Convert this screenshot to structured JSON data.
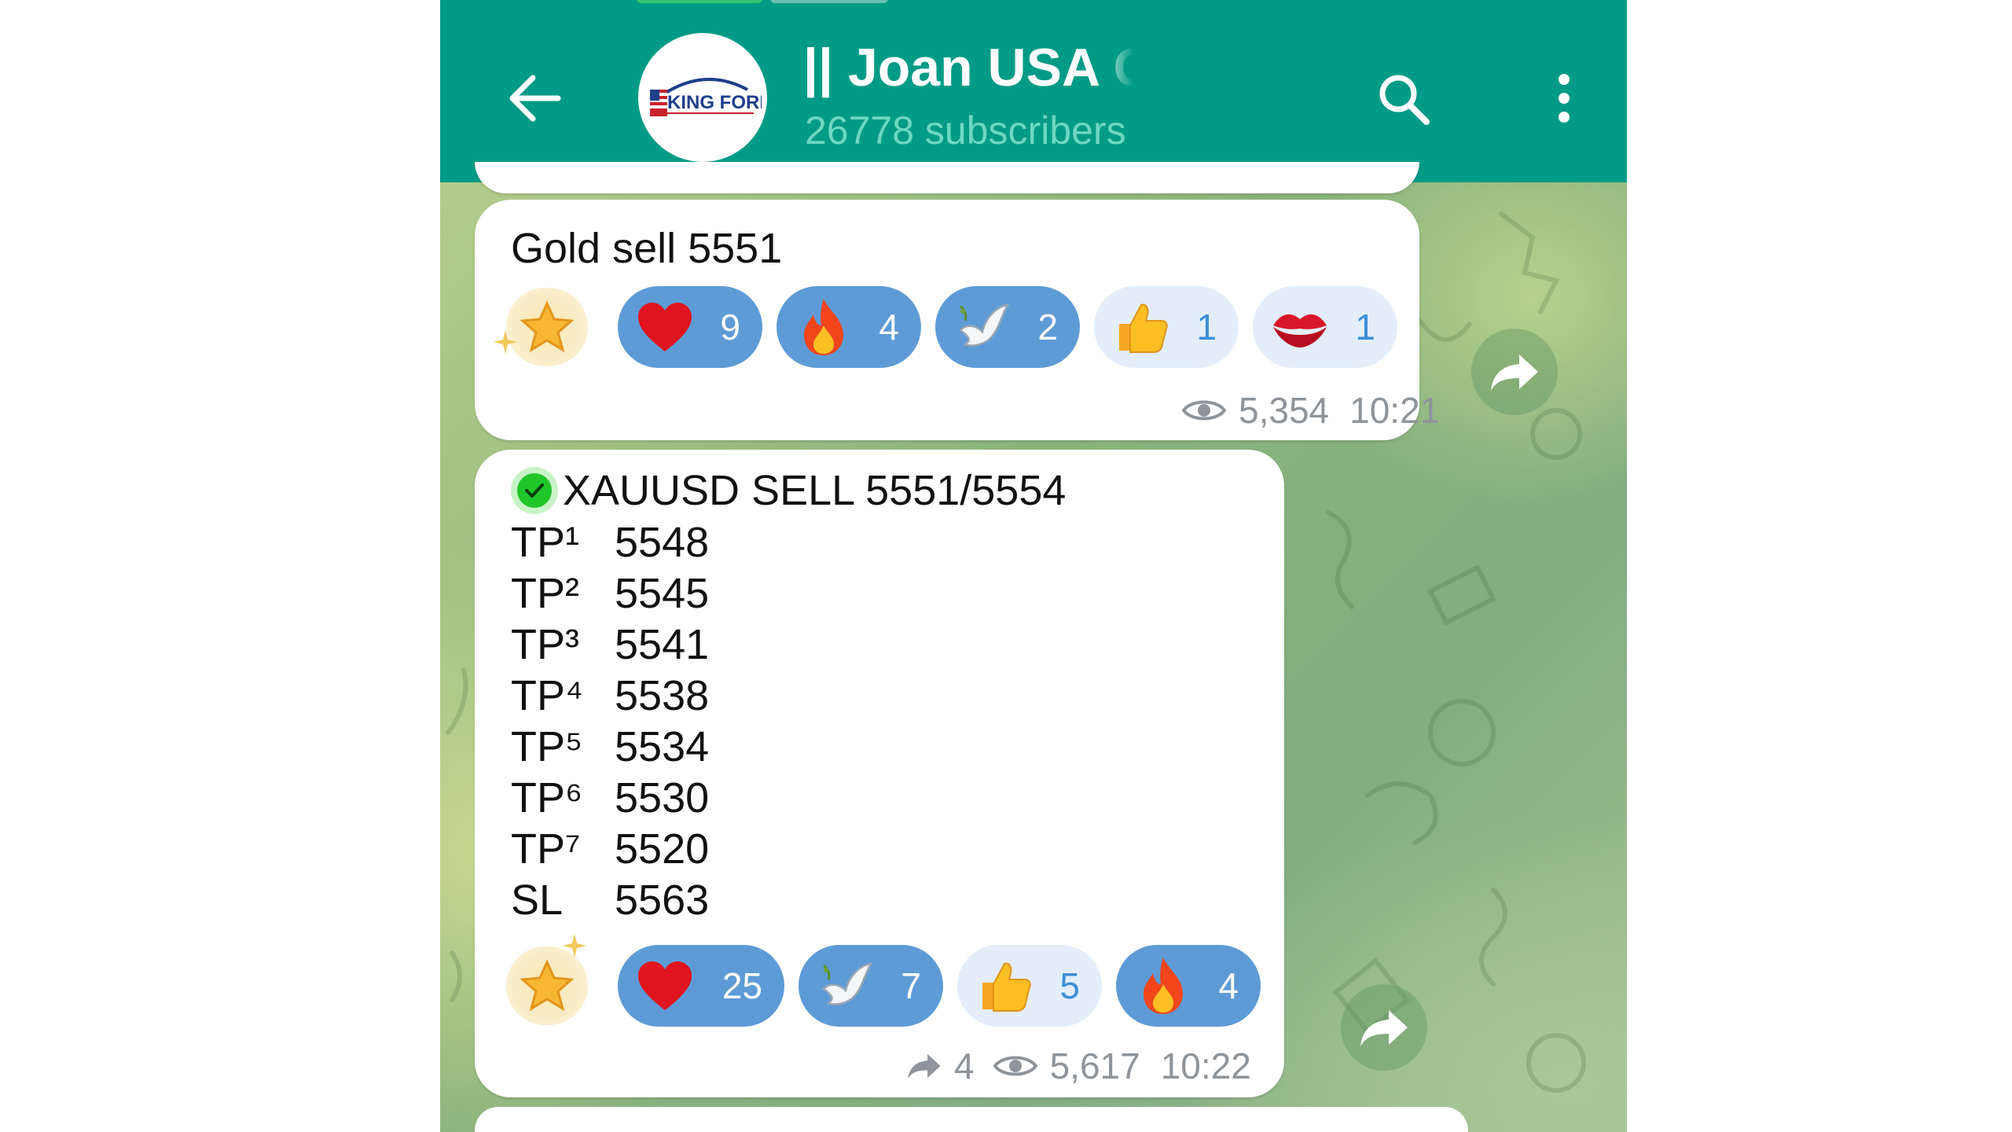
{
  "header": {
    "title": "|| Joan USA GOLD Fx",
    "subtitle": "26778 subscribers",
    "avatar_logo_text": "KING FOREX",
    "colors": {
      "bar": "#009b86",
      "subtitle": "#6fd6c3"
    }
  },
  "messages": [
    {
      "text": "Gold sell 5551",
      "reactions": [
        {
          "icon": "star-icon",
          "count": ""
        },
        {
          "icon": "heart-icon",
          "count": "9"
        },
        {
          "icon": "fire-icon",
          "count": "4"
        },
        {
          "icon": "dove-icon",
          "count": "2"
        },
        {
          "icon": "thumbs-up-icon",
          "count": "1"
        },
        {
          "icon": "kiss-icon",
          "count": "1"
        }
      ],
      "views": "5,354",
      "time": "10:21"
    },
    {
      "headline": "XAUUSD SELL 5551/5554",
      "levels": [
        {
          "label": "TP¹",
          "value": "5548"
        },
        {
          "label": "TP²",
          "value": "5545"
        },
        {
          "label": "TP³",
          "value": "5541"
        },
        {
          "label": "TP⁴",
          "value": "5538"
        },
        {
          "label": "TP⁵",
          "value": "5534"
        },
        {
          "label": "TP⁶",
          "value": "5530"
        },
        {
          "label": "TP⁷",
          "value": "5520"
        },
        {
          "label": "SL",
          "value": "5563"
        }
      ],
      "reactions": [
        {
          "icon": "star-icon",
          "count": ""
        },
        {
          "icon": "heart-icon",
          "count": "25"
        },
        {
          "icon": "dove-icon",
          "count": "7"
        },
        {
          "icon": "thumbs-up-icon",
          "count": "5"
        },
        {
          "icon": "fire-icon",
          "count": "4"
        }
      ],
      "shares": "4",
      "views": "5,617",
      "time": "10:22"
    }
  ]
}
